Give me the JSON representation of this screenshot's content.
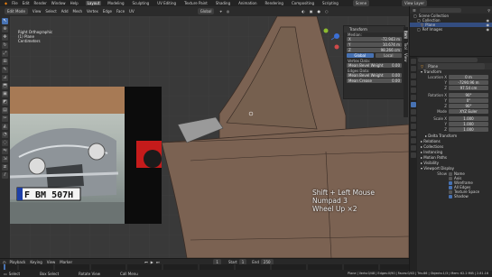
{
  "topbar": {
    "menus": [
      "File",
      "Edit",
      "Render",
      "Window",
      "Help"
    ],
    "workspaces": [
      "Layout",
      "Modeling",
      "Sculpting",
      "UV Editing",
      "Texture Paint",
      "Shading",
      "Animation",
      "Rendering",
      "Compositing",
      "Scripting"
    ],
    "active_workspace": "Layout",
    "scene": "Scene",
    "view_layer": "View Layer"
  },
  "viewport_header": {
    "mode": "Edit Mode",
    "menus": [
      "View",
      "Select",
      "Add",
      "Mesh",
      "Vertex",
      "Edge",
      "Face",
      "UV"
    ],
    "orientation": "Global"
  },
  "viewport": {
    "view_name": "Right Orthographic",
    "collection": "(1) Plane",
    "units": "Centimeters",
    "key_overlay": [
      "Shift + Left Mouse",
      "Numpad 3",
      "Wheel Up ×2"
    ],
    "car_color": "#7b6252",
    "background": "#393939"
  },
  "toolbar": {
    "tools": [
      "select-icon",
      "cursor-icon",
      "move-icon",
      "rotate-icon",
      "scale-icon",
      "transform-icon",
      "annotate-icon",
      "measure-icon",
      "extrude-icon",
      "inset-icon",
      "bevel-icon",
      "loop-cut-icon",
      "knife-icon",
      "poly-build-icon",
      "spin-icon",
      "smooth-icon",
      "edge-slide-icon",
      "shrink-icon",
      "shear-icon",
      "rip-icon"
    ]
  },
  "npanel": {
    "title": "Transform",
    "median_label": "Median:",
    "fields": [
      {
        "axis": "X",
        "value": "-72.943 m"
      },
      {
        "axis": "Y",
        "value": "10.674 m"
      },
      {
        "axis": "Z",
        "value": "98.266 cm"
      }
    ],
    "space_buttons": [
      "Global",
      "Local"
    ],
    "vertex_data": "Vertex Data:",
    "vertex_bevel": "Mean Bevel Weight",
    "vertex_bevel_value": "0.00",
    "edges_data": "Edges Data:",
    "edge_bevel": "Mean Bevel Weight",
    "edge_bevel_value": "0.00",
    "crease": "Mean Crease",
    "crease_value": "0.00",
    "tabs": [
      "Item",
      "Tool",
      "View"
    ]
  },
  "outliner": {
    "title": "Scene Collection",
    "items": [
      {
        "name": "Scene Collection",
        "indent": 0
      },
      {
        "name": "Collection",
        "indent": 1
      },
      {
        "name": "Plane",
        "indent": 2
      },
      {
        "name": "Ref Images",
        "indent": 1
      }
    ]
  },
  "properties": {
    "object_name": "Plane",
    "transform_title": "Transform",
    "location": [
      "0 m",
      "-7290.96 m",
      "97.54 cm"
    ],
    "rotation": [
      "90°",
      "0°",
      "90°"
    ],
    "mode_label": "Mode",
    "mode_value": "XYZ Euler",
    "scale": [
      "1.000",
      "1.000",
      "1.000"
    ],
    "delta_transform": "Delta Transform",
    "sections": [
      "Relations",
      "Collections",
      "Instancing",
      "Motion Paths",
      "Visibility",
      "Viewport Display"
    ],
    "viewport_display": {
      "show_label": "Show",
      "options": [
        {
          "label": "Name",
          "on": false
        },
        {
          "label": "Axis",
          "on": false
        },
        {
          "label": "Wireframe",
          "on": true
        },
        {
          "label": "All Edges",
          "on": true
        },
        {
          "label": "Texture Space",
          "on": false
        },
        {
          "label": "Shadow",
          "on": true
        }
      ]
    }
  },
  "timeline": {
    "playback": "Playback",
    "keying": "Keying",
    "view": "View",
    "marker": "Marker",
    "current_frame": "1",
    "start_label": "Start",
    "start": "1",
    "end_label": "End",
    "end": "250"
  },
  "statusbar": {
    "items": [
      "Select",
      "Box Select",
      "Rotate View",
      "Call Menu"
    ],
    "stats": "Plane | Verts:0/48 | Edges:0/90 | Faces:0/43 | Tris:86 | Objects:1/3 | Mem: 62.2 MiB | 2.81.16"
  },
  "photo": {
    "plate": "F BM 507H"
  },
  "colors": {
    "accent": "#4772b3",
    "panel": "#2b2b2b",
    "car_body": "#7b6252",
    "car_line": "#3a2d26"
  }
}
